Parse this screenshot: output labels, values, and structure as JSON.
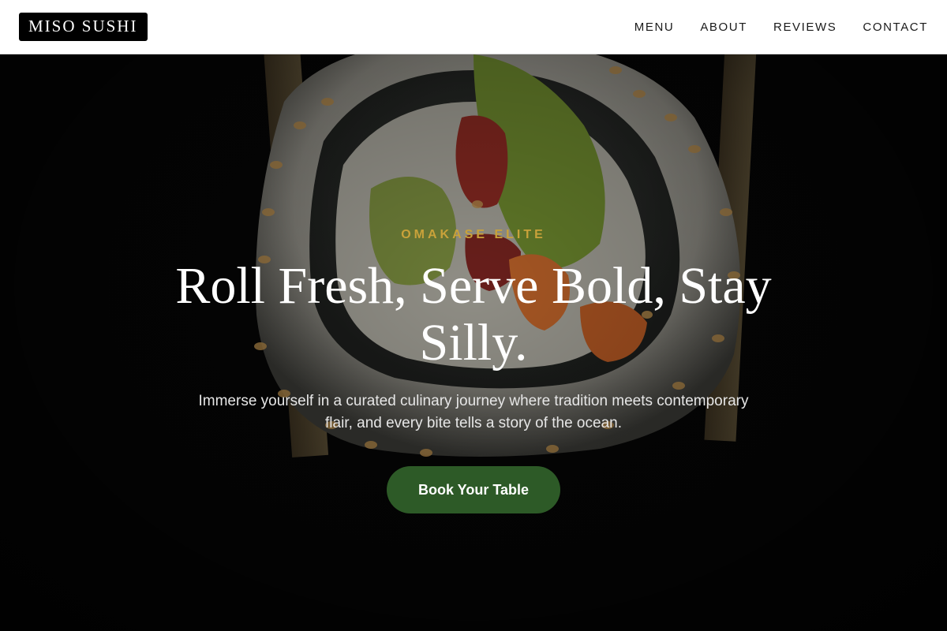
{
  "header": {
    "logo": "MISO SUSHI",
    "nav": [
      {
        "label": "MENU"
      },
      {
        "label": "ABOUT"
      },
      {
        "label": "REVIEWS"
      },
      {
        "label": "CONTACT"
      }
    ]
  },
  "hero": {
    "image": "sushi-roll-closeup",
    "eyebrow": "OMAKASE ELITE",
    "headline": "Roll Fresh, Serve Bold, Stay Silly.",
    "subtext": "Immerse yourself in a curated culinary journey where tradition meets contemporary flair, and every bite tells a story of the ocean.",
    "cta_label": "Book Your Table"
  },
  "colors": {
    "accent_gold": "#c9a23a",
    "button_green": "#2d5a27",
    "header_bg": "#ffffff",
    "hero_bg": "#000000"
  }
}
